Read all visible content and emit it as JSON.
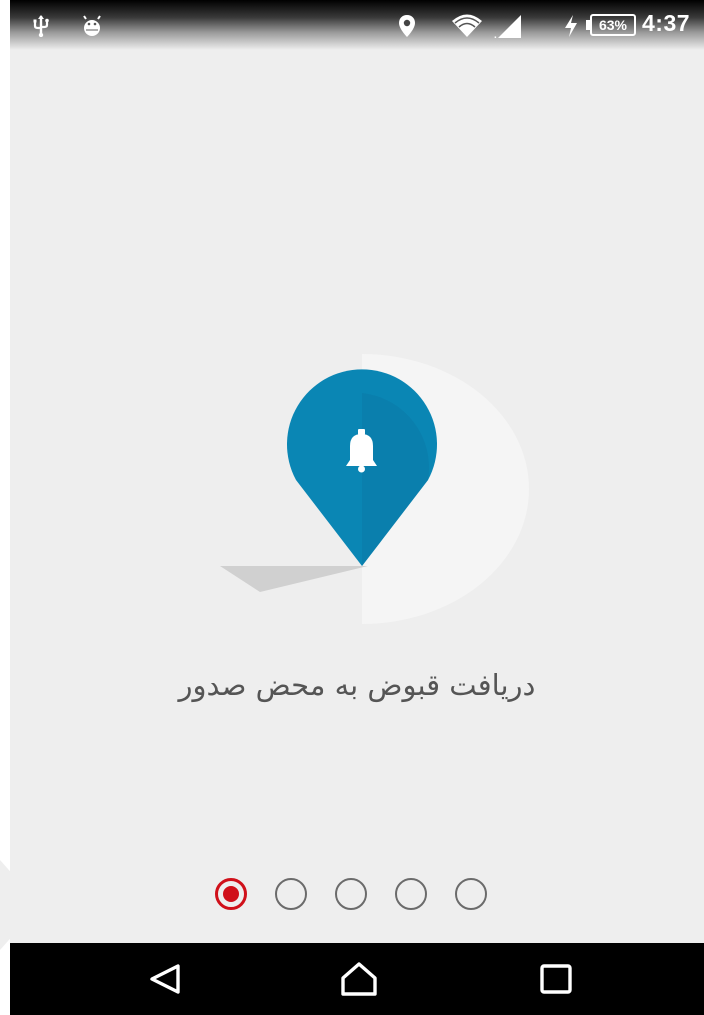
{
  "status_bar": {
    "left_icons": [
      "usb-icon",
      "android-debug-icon"
    ],
    "right_icons": [
      "location-icon",
      "wifi-icon",
      "cell-signal-icon",
      "charging-icon"
    ],
    "battery_percent": "63%",
    "time": "4:37"
  },
  "onboarding": {
    "illustration_icon": "bell-map-pin-icon",
    "caption": "دریافت قبوض به محض صدور",
    "page_count": 5,
    "active_page": 1,
    "accent_color": "#0a86b4",
    "indicator_active_color": "#d0101a"
  },
  "nav_bar": {
    "buttons": [
      "back-icon",
      "home-icon",
      "recents-icon"
    ]
  }
}
